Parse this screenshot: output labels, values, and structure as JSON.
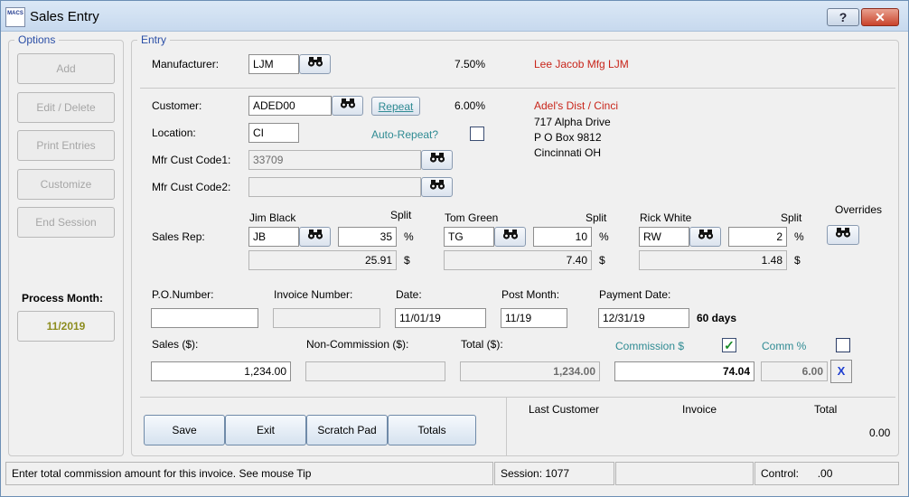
{
  "window": {
    "title": "Sales Entry",
    "app_icon_text": "MACS"
  },
  "options": {
    "legend": "Options",
    "buttons": [
      {
        "label": "Add"
      },
      {
        "label": "Edit / Delete"
      },
      {
        "label": "Print Entries"
      },
      {
        "label": "Customize"
      },
      {
        "label": "End Session"
      }
    ],
    "process_month_label": "Process Month:",
    "process_month_value": "11/2019"
  },
  "entry": {
    "legend": "Entry",
    "manufacturer": {
      "label": "Manufacturer:",
      "value": "LJM",
      "percent": "7.50%",
      "name": "Lee Jacob Mfg  LJM"
    },
    "customer": {
      "label": "Customer:",
      "value": "ADED00",
      "repeat_label": "Repeat",
      "percent": "6.00%",
      "name": "Adel's Dist / Cinci",
      "address": [
        "717 Alpha Drive",
        "P O Box 9812",
        "Cincinnati OH"
      ]
    },
    "location": {
      "label": "Location:",
      "value": "CI",
      "auto_repeat_label": "Auto-Repeat?"
    },
    "mfr_cust_code1": {
      "label": "Mfr Cust Code1:",
      "value": "33709"
    },
    "mfr_cust_code2": {
      "label": "Mfr Cust Code2:",
      "value": ""
    },
    "sales_rep": {
      "label": "Sales Rep:",
      "split_label": "Split",
      "percent_sign": "%",
      "dollar_sign": "$",
      "overrides_label": "Overrides",
      "reps": [
        {
          "name": "Jim Black",
          "code": "JB",
          "split": "35",
          "amount": "25.91"
        },
        {
          "name": "Tom Green",
          "code": "TG",
          "split": "10",
          "amount": "7.40"
        },
        {
          "name": "Rick White",
          "code": "RW",
          "split": "2",
          "amount": "1.48"
        }
      ]
    },
    "po_number": {
      "label": "P.O.Number:",
      "value": ""
    },
    "invoice_number": {
      "label": "Invoice Number:",
      "value": ""
    },
    "date": {
      "label": "Date:",
      "value": "11/01/19"
    },
    "post_month": {
      "label": "Post Month:",
      "value": "11/19"
    },
    "payment_date": {
      "label": "Payment Date:",
      "value": "12/31/19",
      "days": "60  days"
    },
    "sales": {
      "label": "Sales ($):",
      "value": "1,234.00"
    },
    "non_commission": {
      "label": "Non-Commission ($):",
      "value": ""
    },
    "total": {
      "label": "Total ($):",
      "value": "1,234.00"
    },
    "commission_dollar": {
      "label": "Commission $",
      "value": "74.04",
      "checked": "✓"
    },
    "commission_pct": {
      "label": "Comm %",
      "value": "6.00",
      "clear": "X"
    }
  },
  "actions": {
    "save": "Save",
    "exit": "Exit",
    "scratch_pad": "Scratch Pad",
    "totals": "Totals"
  },
  "summary": {
    "last_customer_label": "Last Customer",
    "invoice_label": "Invoice",
    "total_label": "Total",
    "total_value": "0.00"
  },
  "statusbar": {
    "message": "Enter total commission amount for this invoice. See mouse Tip",
    "session": "Session: 1077",
    "blank": "",
    "control_label": "Control:",
    "control_value": ".00"
  },
  "colors": {
    "accent_blue": "#2a4ea6",
    "link_teal": "#2f8b93",
    "name_red": "#c8251a",
    "process_month_olive": "#8d8d1f"
  }
}
